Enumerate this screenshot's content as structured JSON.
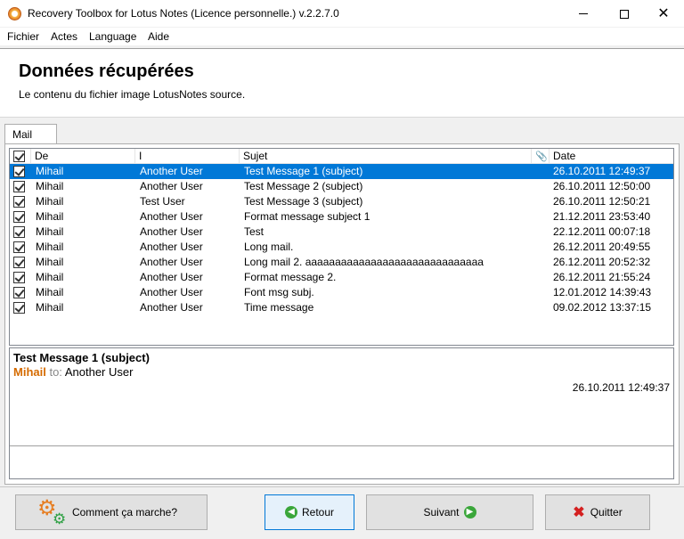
{
  "window": {
    "title": "Recovery Toolbox for Lotus Notes (Licence personnelle.) v.2.2.7.0",
    "minimize_icon": "minimize-icon",
    "maximize_icon": "maximize-icon",
    "close_icon": "close-icon",
    "close_glyph": "✕"
  },
  "menu": {
    "items": [
      "Fichier",
      "Actes",
      "Language",
      "Aide"
    ]
  },
  "header": {
    "title": "Données récupérées",
    "subtitle": "Le contenu du fichier image LotusNotes source."
  },
  "tabs": [
    {
      "label": "Mail"
    }
  ],
  "grid": {
    "columns": [
      "De",
      "I",
      "Sujet",
      "Date"
    ],
    "attachment_glyph": "📎",
    "selected_row": 0,
    "selection_color": "#0078d7",
    "rows": [
      {
        "checked": true,
        "from": "Mihail",
        "to": "Another User",
        "subject": "Test Message 1 (subject)",
        "date": "26.10.2011 12:49:37"
      },
      {
        "checked": true,
        "from": "Mihail",
        "to": "Another User",
        "subject": "Test Message 2 (subject)",
        "date": "26.10.2011 12:50:00"
      },
      {
        "checked": true,
        "from": "Mihail",
        "to": "Test User",
        "subject": "Test Message 3 (subject)",
        "date": "26.10.2011 12:50:21"
      },
      {
        "checked": true,
        "from": "Mihail",
        "to": "Another User",
        "subject": "Format message subject 1",
        "date": "21.12.2011 23:53:40"
      },
      {
        "checked": true,
        "from": "Mihail",
        "to": "Another User",
        "subject": "Test",
        "date": "22.12.2011 00:07:18"
      },
      {
        "checked": true,
        "from": "Mihail",
        "to": "Another User",
        "subject": "Long mail.",
        "date": "26.12.2011 20:49:55"
      },
      {
        "checked": true,
        "from": "Mihail",
        "to": "Another User",
        "subject": "Long mail 2. aaaaaaaaaaaaaaaaaaaaaaaaaaaaaa",
        "date": "26.12.2011 20:52:32"
      },
      {
        "checked": true,
        "from": "Mihail",
        "to": "Another User",
        "subject": "Format message 2.",
        "date": "26.12.2011 21:55:24"
      },
      {
        "checked": true,
        "from": "Mihail",
        "to": "Another User",
        "subject": "Font msg subj.",
        "date": "12.01.2012 14:39:43"
      },
      {
        "checked": true,
        "from": "Mihail",
        "to": "Another User",
        "subject": "Time message",
        "date": "09.02.2012 13:37:15"
      }
    ]
  },
  "preview": {
    "subject": "Test Message 1 (subject)",
    "sender": "Mihail",
    "to_label": "to:",
    "recipient": "Another User",
    "date": "26.10.2011 12:49:37",
    "sender_color": "#d56b00"
  },
  "buttons": {
    "how_it_works": "Comment ça marche?",
    "back": "Retour",
    "next": "Suivant",
    "quit": "Quitter",
    "back_glyph": "◀",
    "next_glyph": "▶",
    "quit_glyph": "✖",
    "gear_glyph": "⚙"
  }
}
